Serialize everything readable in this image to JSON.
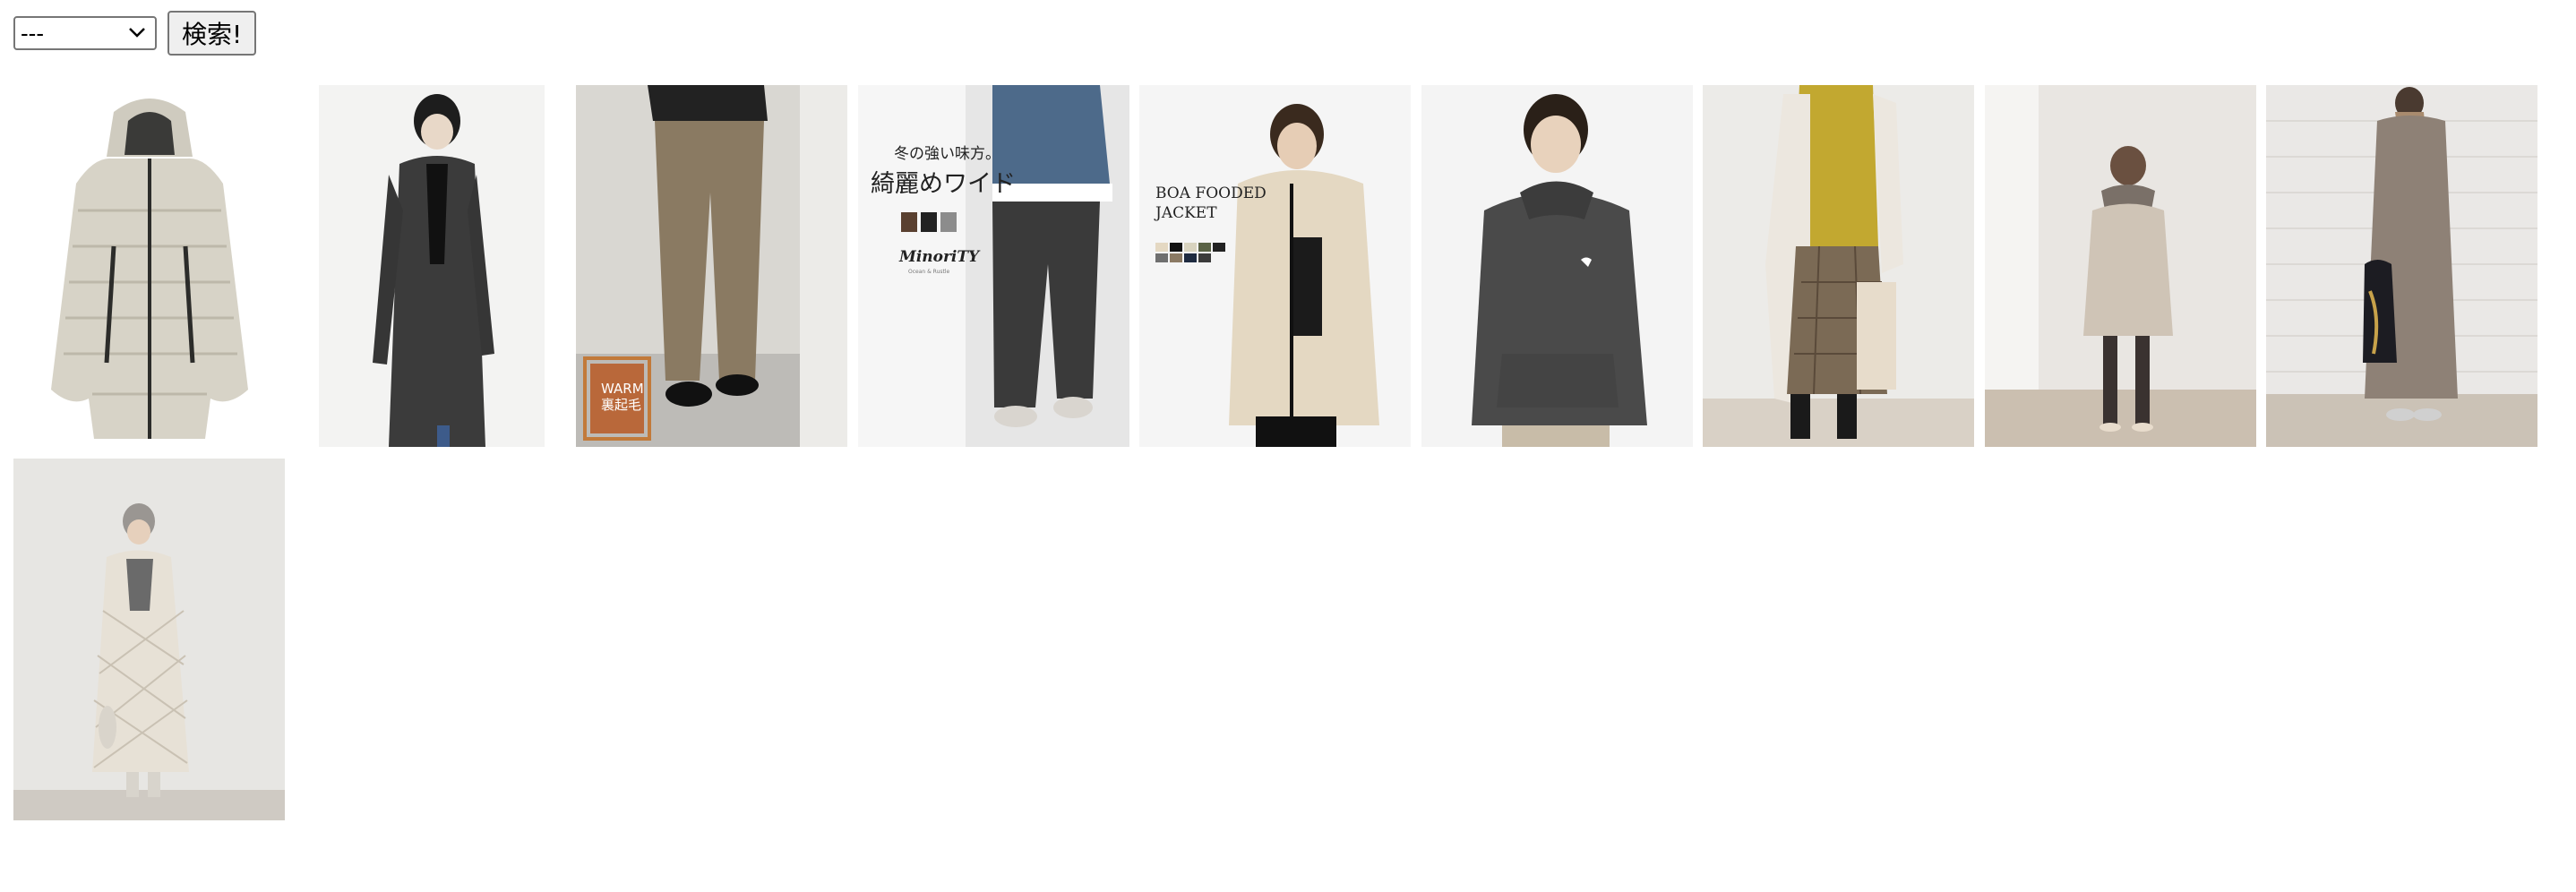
{
  "search": {
    "selected_option": "---",
    "button_label": "検索!"
  },
  "products": [
    {
      "icon": "down-jacket-image"
    },
    {
      "icon": "chester-coat-image"
    },
    {
      "icon": "tapered-pants-image",
      "badge_line1": "WARM",
      "badge_line2": "裏起毛"
    },
    {
      "icon": "wide-pants-image",
      "tagline": "冬の強い味方。",
      "headline": "綺麗めワイド",
      "brand": "MinoriTY",
      "brand_sub": "Ocean & Rustle"
    },
    {
      "icon": "boa-hooded-jacket-image",
      "title_line1": "BOA FOODED",
      "title_line2": "JACKET"
    },
    {
      "icon": "gray-hoodie-image"
    },
    {
      "icon": "white-coat-mustard-knit-image"
    },
    {
      "icon": "beige-coat-scarf-image"
    },
    {
      "icon": "long-chester-coat-image"
    },
    {
      "icon": "quilted-long-coat-image"
    }
  ]
}
